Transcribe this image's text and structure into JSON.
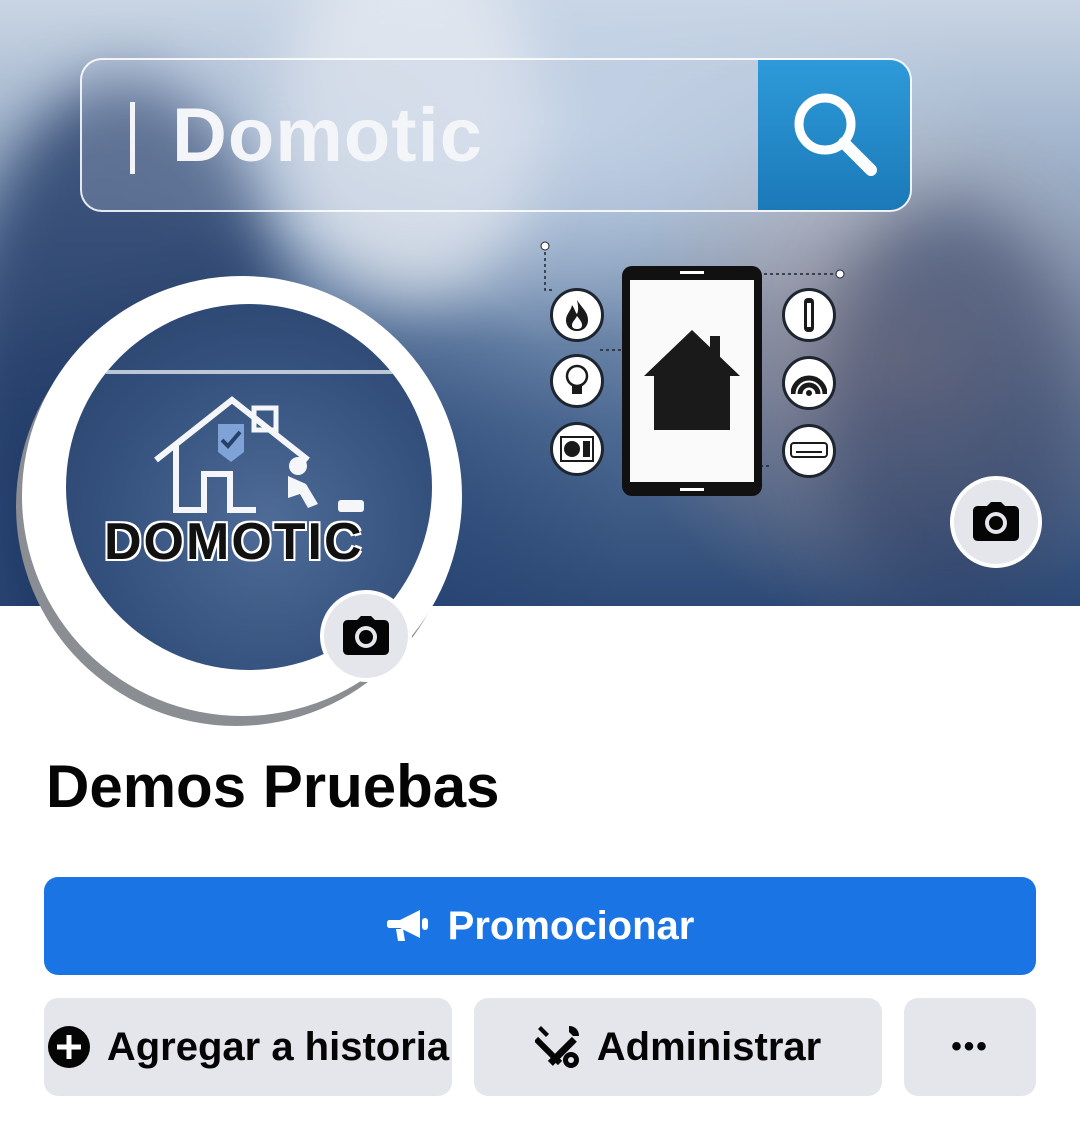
{
  "cover": {
    "search_query": "Domotic"
  },
  "avatar": {
    "logo_text": "DOMOTIC"
  },
  "page": {
    "name": "Demos Pruebas"
  },
  "actions": {
    "promote_label": "Promocionar",
    "add_story_label": "Agregar a historia",
    "manage_label": "Administrar",
    "more_label": "•••"
  },
  "colors": {
    "primary": "#1b74e4",
    "secondary_button": "#e4e6eb",
    "text": "#050505"
  },
  "icons": {
    "cover_camera": "camera-icon",
    "avatar_camera": "camera-icon",
    "promote": "megaphone-icon",
    "add_story": "plus-circle-icon",
    "manage": "tools-icon",
    "more": "ellipsis-icon"
  }
}
